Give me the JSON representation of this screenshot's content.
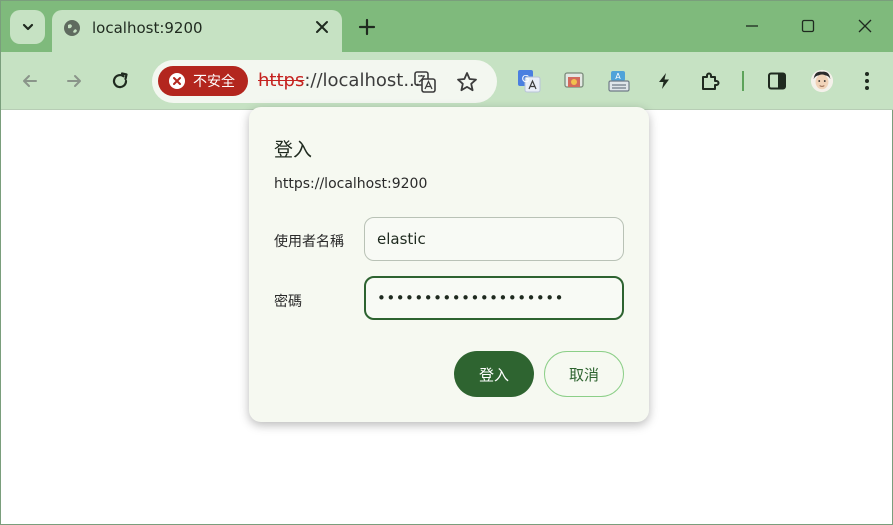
{
  "tab": {
    "title": "localhost:9200",
    "favicon": "globe-icon"
  },
  "toolbar": {
    "security_chip": "不安全",
    "url_scheme": "https",
    "url_rest": "://localhost..."
  },
  "dialog": {
    "title": "登入",
    "origin": "https://localhost:9200",
    "username_label": "使用者名稱",
    "username_value": "elastic",
    "password_label": "密碼",
    "password_masked": "••••••••••••••••••••",
    "ok_label": "登入",
    "cancel_label": "取消"
  },
  "colors": {
    "frame": "#7fba7c",
    "toolbar": "#c6e2c3",
    "insecure": "#b3261e",
    "primary": "#2e6430"
  }
}
